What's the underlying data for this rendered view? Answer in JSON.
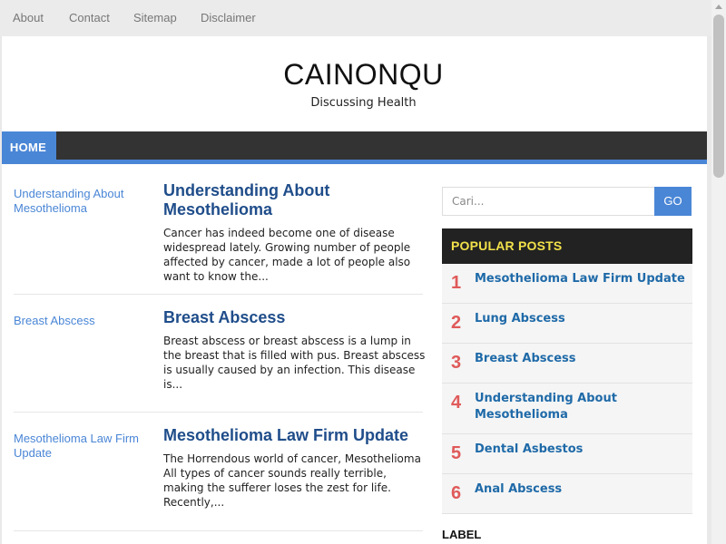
{
  "top_nav": [
    "About",
    "Contact",
    "Sitemap",
    "Disclaimer"
  ],
  "site": {
    "title": "CAINONQU",
    "description": "Discussing Health"
  },
  "main_nav": {
    "home": "HOME"
  },
  "posts": [
    {
      "thumb_alt": "Understanding About Mesothelioma",
      "title": "Understanding About Mesothelioma",
      "excerpt": "Cancer has indeed become one of disease widespread lately. Growing number of people affected by cancer, made a lot of people also want to know the..."
    },
    {
      "thumb_alt": "Breast Abscess",
      "title": "Breast Abscess",
      "excerpt": "Breast abscess or breast abscess is a lump in the breast that is filled with pus. Breast abscess is usually caused by an infection. This disease is..."
    },
    {
      "thumb_alt": "Mesothelioma Law Firm Update",
      "title": "Mesothelioma Law Firm Update",
      "excerpt": "The Horrendous world of cancer, Mesothelioma All types of cancer sounds really terrible, making the sufferer loses the zest for life. Recently,..."
    }
  ],
  "search": {
    "placeholder": "Cari...",
    "button": "GO"
  },
  "popular": {
    "heading": "POPULAR POSTS",
    "items": [
      {
        "num": "1",
        "title": "Mesothelioma Law Firm Update"
      },
      {
        "num": "2",
        "title": "Lung Abscess"
      },
      {
        "num": "3",
        "title": "Breast Abscess"
      },
      {
        "num": "4",
        "title": "Understanding About Mesothelioma"
      },
      {
        "num": "5",
        "title": "Dental Asbestos"
      },
      {
        "num": "6",
        "title": "Anal Abscess"
      }
    ]
  },
  "label_heading": "LABEL",
  "colors": {
    "accent": "#4a86d6",
    "nav_bg": "#333333",
    "post_title": "#1f4d8a",
    "popular_num": "#e05a5a",
    "popular_heading": "#f2e14a"
  }
}
